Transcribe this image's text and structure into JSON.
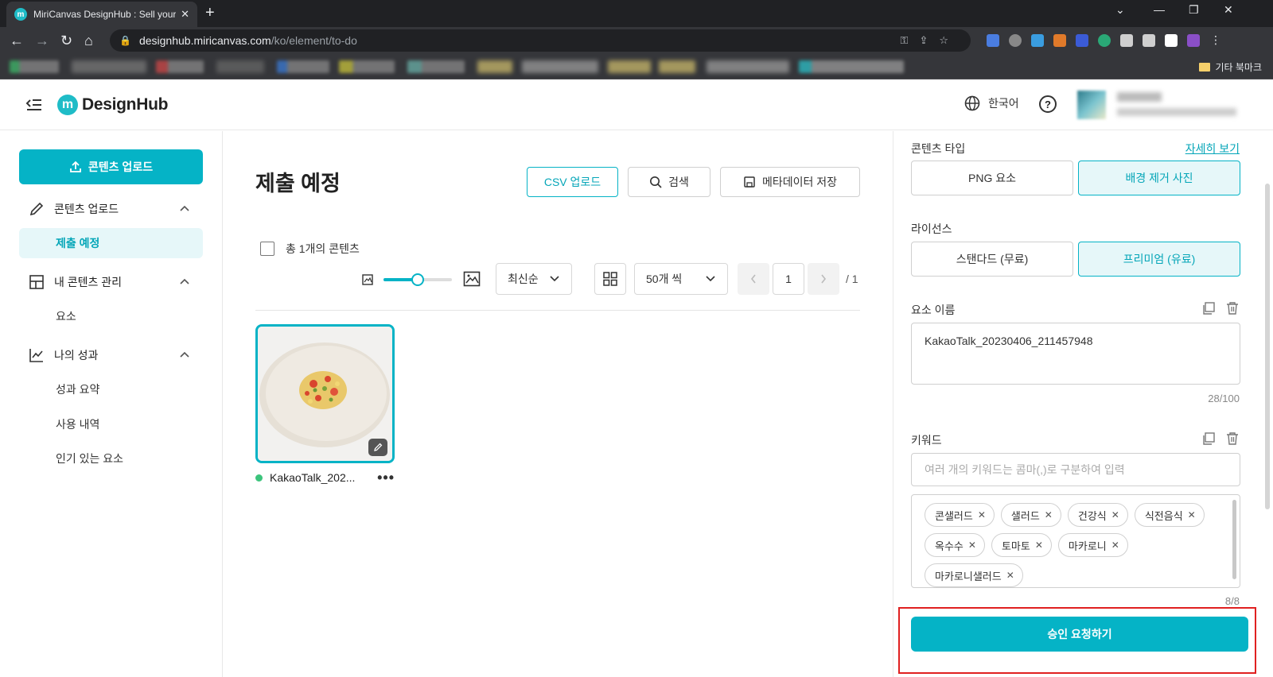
{
  "browser": {
    "tab_title": "MiriCanvas DesignHub : Sell your designs",
    "tab_favicon": "m",
    "url_host": "designhub.miricanvas.com",
    "url_path": "/ko/element/to-do",
    "other_bookmarks": "기타 북마크"
  },
  "header": {
    "logo_mark": "m",
    "logo_text": "DesignHub",
    "language": "한국어",
    "help": "?"
  },
  "sidebar": {
    "upload_button": "콘텐츠 업로드",
    "sections": [
      {
        "label": "콘텐츠 업로드",
        "items": [
          "제출 예정"
        ]
      },
      {
        "label": "내 콘텐츠 관리",
        "items": [
          "요소"
        ]
      },
      {
        "label": "나의 성과",
        "items": [
          "성과 요약",
          "사용 내역",
          "인기 있는 요소"
        ]
      }
    ]
  },
  "main": {
    "title": "제출 예정",
    "csv_button": "CSV 업로드",
    "search_button": "검색",
    "save_meta_button": "메타데이터 저장",
    "select_all_label": "총 1개의 콘텐츠",
    "sort_value": "최신순",
    "per_page_value": "50개 씩",
    "current_page": "1",
    "total_pages": "/ 1",
    "zoom_level": 0.5,
    "items": [
      {
        "name": "KakaoTalk_202...",
        "status_color": "#3cc47c"
      }
    ]
  },
  "panel": {
    "content_type_label": "콘텐츠 타입",
    "details_link": "자세히 보기",
    "type_options": [
      "PNG 요소",
      "배경 제거 사진"
    ],
    "license_label": "라이선스",
    "license_options": [
      "스탠다드 (무료)",
      "프리미엄 (유료)"
    ],
    "name_label": "요소 이름",
    "name_value": "KakaoTalk_20230406_211457948",
    "name_counter": "28/100",
    "keyword_label": "키워드",
    "keyword_placeholder": "여러 개의 키워드는 콤마(,)로 구분하여 입력",
    "keywords": [
      "콘샐러드",
      "샐러드",
      "건강식",
      "식전음식",
      "옥수수",
      "토마토",
      "마카로니",
      "마카로니샐러드"
    ],
    "keyword_counter": "8/8",
    "submit_button": "승인 요청하기"
  },
  "colors": {
    "accent": "#05b3c6",
    "accent_light": "#e6f7f9",
    "highlight": "#e02020"
  }
}
